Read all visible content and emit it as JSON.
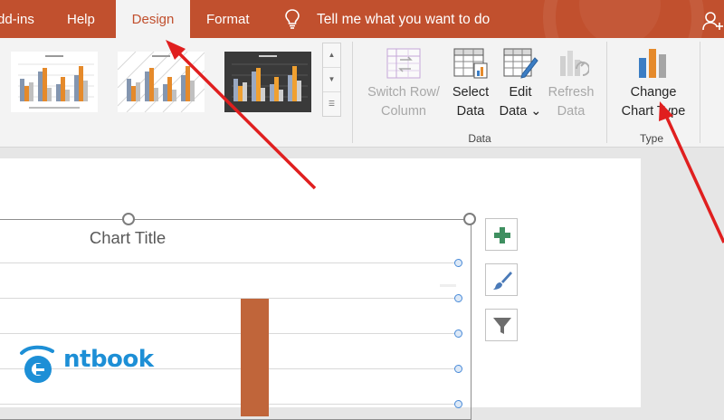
{
  "ribbon_tabs": [
    {
      "label": "dd-ins"
    },
    {
      "label": "Help"
    },
    {
      "label": "Design",
      "active": true
    },
    {
      "label": "Format"
    }
  ],
  "tell_me": "Tell me what you want to do",
  "data_group": {
    "switch_row_column": "Switch Row/\nColumn",
    "select_data": "Select\nData",
    "edit_data": "Edit\nData ⌄",
    "refresh_data": "Refresh\nData",
    "label": "Data"
  },
  "type_group": {
    "change_chart_type": "Change\nChart Type",
    "label": "Type"
  },
  "chart": {
    "title": "Chart Title"
  },
  "side_buttons": [
    "chart-elements",
    "chart-styles",
    "chart-filters"
  ],
  "logo": {
    "text": "ntbook"
  },
  "colors": {
    "accent": "#c1502e",
    "bar": "#c0653a",
    "annotation_arrow": "#e01f1f",
    "logo": "#1d8fd6"
  }
}
